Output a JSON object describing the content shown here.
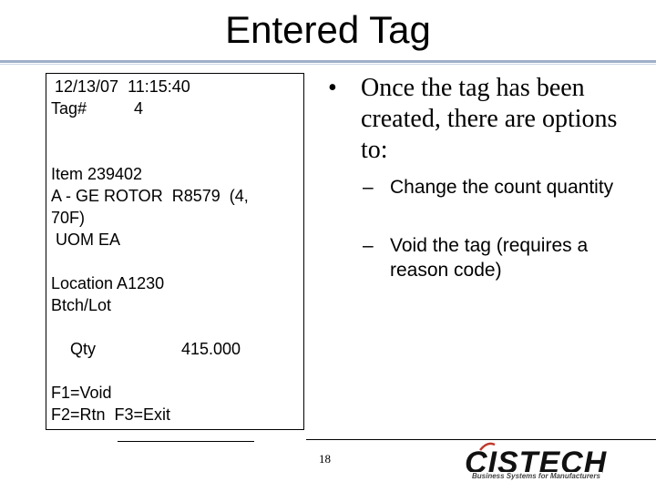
{
  "slide": {
    "title": "Entered Tag",
    "page_number": "18"
  },
  "terminal": {
    "datetime": " 12/13/07  11:15:40",
    "tag_label": "Tag#",
    "tag_value": "4",
    "item": "Item 239402",
    "desc_line1": "A - GE ROTOR  R8579  (4,",
    "desc_line2": "70F)",
    "uom": " UOM EA",
    "location": "Location A1230",
    "batch_lot": "Btch/Lot",
    "qty_label": "Qty",
    "qty_value": "415.000",
    "f1": "F1=Void",
    "f2f3": "F2=Rtn  F3=Exit"
  },
  "notes": {
    "bullet_marker": "•",
    "bullet_text": "Once the tag has been created, there are options to:",
    "sub_marker": "–",
    "sub_items": [
      "Change the count quantity",
      "Void the tag (requires a reason code)"
    ]
  },
  "logo": {
    "text": "CISTECH",
    "tagline": "Business Systems for Manufacturers",
    "color": "#111111",
    "accent_color": "#c0392b"
  },
  "colors": {
    "title_rule": "#9fb0c8"
  }
}
